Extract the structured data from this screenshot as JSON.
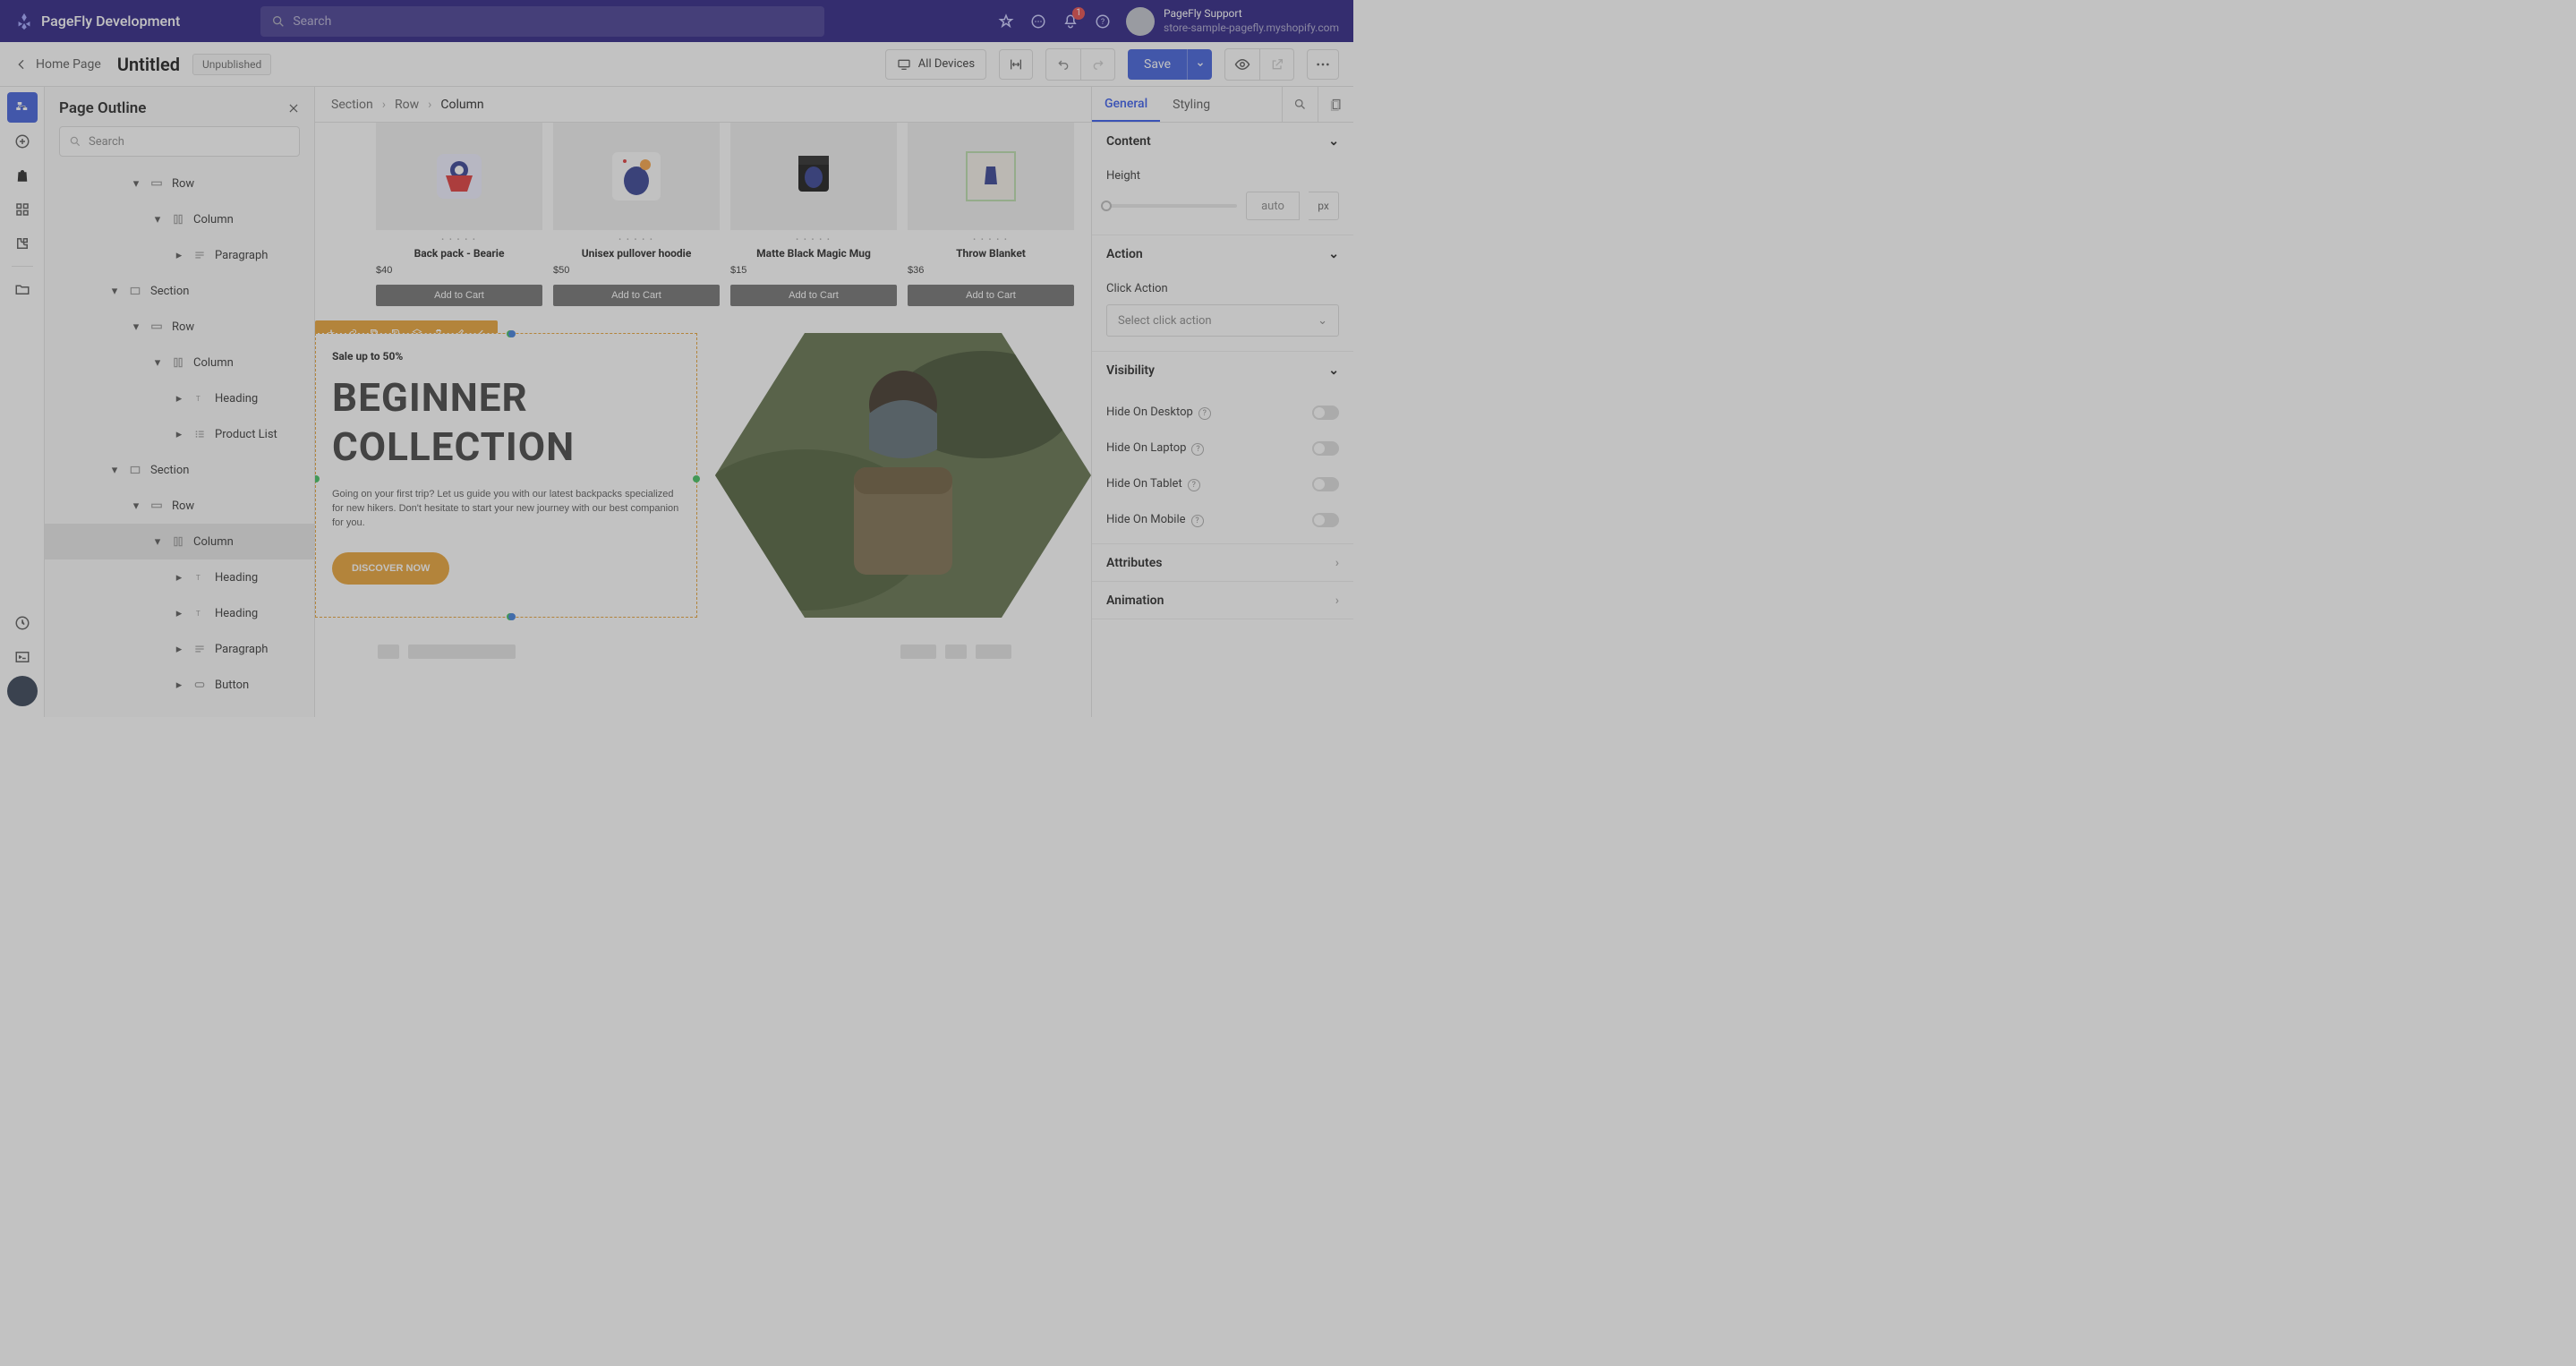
{
  "topbar": {
    "brand": "PageFly Development",
    "search_placeholder": "Search",
    "notif_count": "1",
    "user_name": "PageFly Support",
    "user_store": "store-sample-pagefly.myshopify.com"
  },
  "toolbar": {
    "back_label": "Home Page",
    "title": "Untitled",
    "status": "Unpublished",
    "devices_label": "All Devices",
    "save_label": "Save"
  },
  "outline": {
    "title": "Page Outline",
    "search_placeholder": "Search",
    "nodes": [
      {
        "label": "Row",
        "indent": 4,
        "caret": "▾",
        "icon": "row"
      },
      {
        "label": "Column",
        "indent": 5,
        "caret": "▾",
        "icon": "column"
      },
      {
        "label": "Paragraph",
        "indent": 6,
        "caret": "▸",
        "icon": "paragraph"
      },
      {
        "label": "Section",
        "indent": 3,
        "caret": "▾",
        "icon": "section"
      },
      {
        "label": "Row",
        "indent": 4,
        "caret": "▾",
        "icon": "row"
      },
      {
        "label": "Column",
        "indent": 5,
        "caret": "▾",
        "icon": "column"
      },
      {
        "label": "Heading",
        "indent": 6,
        "caret": "▸",
        "icon": "heading"
      },
      {
        "label": "Product List",
        "indent": 6,
        "caret": "▸",
        "icon": "list"
      },
      {
        "label": "Section",
        "indent": 3,
        "caret": "▾",
        "icon": "section"
      },
      {
        "label": "Row",
        "indent": 4,
        "caret": "▾",
        "icon": "row"
      },
      {
        "label": "Column",
        "indent": 5,
        "caret": "▾",
        "icon": "column",
        "selected": true
      },
      {
        "label": "Heading",
        "indent": 6,
        "caret": "▸",
        "icon": "heading"
      },
      {
        "label": "Heading",
        "indent": 6,
        "caret": "▸",
        "icon": "heading"
      },
      {
        "label": "Paragraph",
        "indent": 6,
        "caret": "▸",
        "icon": "paragraph"
      },
      {
        "label": "Button",
        "indent": 6,
        "caret": "▸",
        "icon": "button"
      }
    ]
  },
  "breadcrumb": {
    "a": "Section",
    "b": "Row",
    "c": "Column"
  },
  "products": [
    {
      "name": "Back pack - Bearie",
      "price": "$40",
      "btn": "Add to Cart"
    },
    {
      "name": "Unisex pullover hoodie",
      "price": "$50",
      "btn": "Add to Cart"
    },
    {
      "name": "Matte Black Magic Mug",
      "price": "$15",
      "btn": "Add to Cart"
    },
    {
      "name": "Throw Blanket",
      "price": "$36",
      "btn": "Add to Cart"
    }
  ],
  "hero": {
    "tag": "Sale up to 50%",
    "heading": "BEGINNER COLLECTION",
    "paragraph": "Going on your first trip? Let us guide you with our latest backpacks specialized for new hikers. Don't hesitate to start your new journey with our best companion for you.",
    "cta": "DISCOVER NOW"
  },
  "props": {
    "tab_general": "General",
    "tab_styling": "Styling",
    "sec_content": "Content",
    "label_height": "Height",
    "height_value": "auto",
    "height_unit": "px",
    "sec_action": "Action",
    "label_click_action": "Click Action",
    "click_action_placeholder": "Select click action",
    "sec_visibility": "Visibility",
    "hide_desktop": "Hide On Desktop",
    "hide_laptop": "Hide On Laptop",
    "hide_tablet": "Hide On Tablet",
    "hide_mobile": "Hide On Mobile",
    "sec_attributes": "Attributes",
    "sec_animation": "Animation"
  }
}
